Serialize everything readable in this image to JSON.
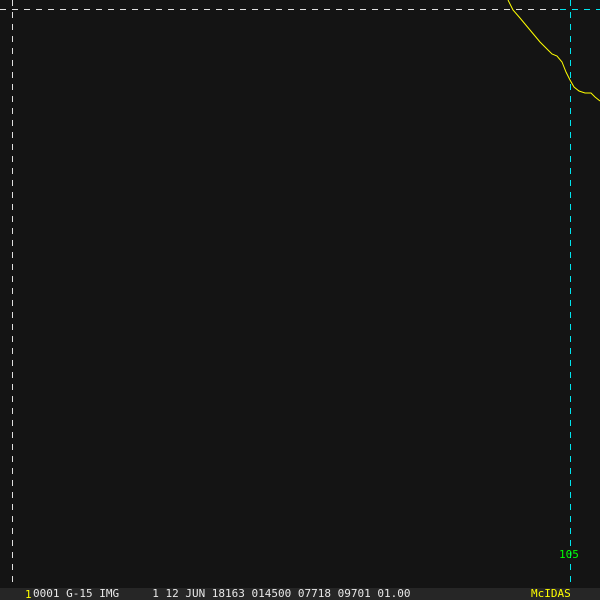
{
  "image": {
    "frame_number": "1",
    "status_line": "0001 G-15 IMG     1 12 JUN 18163 014500 07718 09701 01.00",
    "brand": "McIDAS",
    "longitude_label": "105"
  },
  "colors": {
    "grid_left": "#e0e0e0",
    "grid_right": "#00e5ee",
    "coastline": "#ffff00",
    "label": "#00ff00"
  }
}
